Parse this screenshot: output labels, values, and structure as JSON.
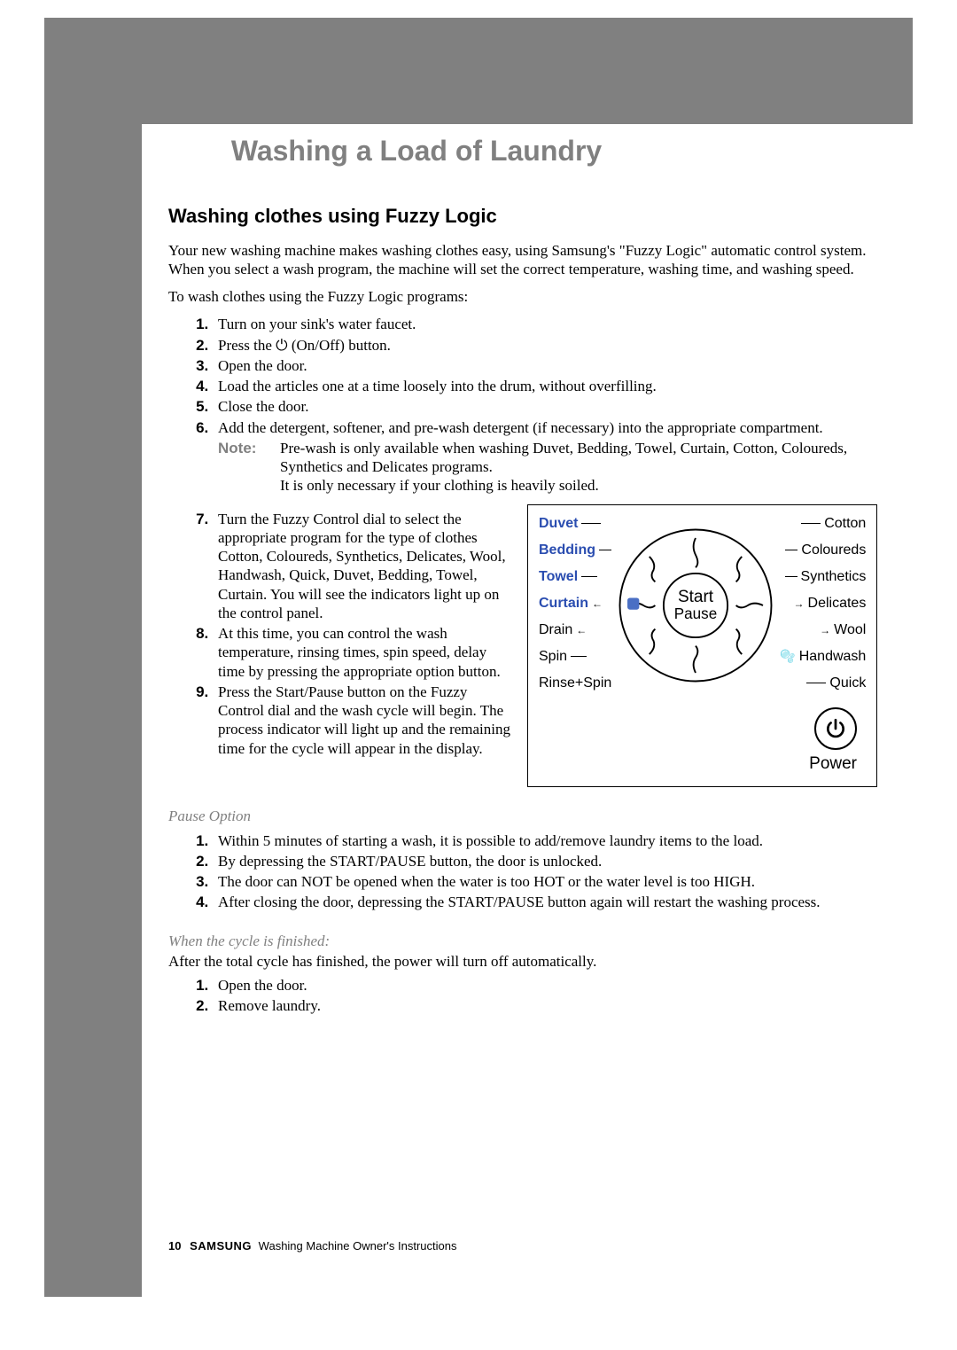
{
  "header": {
    "title": "Washing a Load of Laundry"
  },
  "section": {
    "heading": "Washing clothes using Fuzzy Logic",
    "intro1": "Your new washing machine makes washing clothes easy, using Samsung's \"Fuzzy Logic\" automatic control system.  When you select a wash program, the machine will set the correct temperature, washing time, and washing speed.",
    "intro2": "To wash clothes using the Fuzzy Logic programs:",
    "steps": [
      "Turn on your sink's water faucet.",
      "Press the ⏻ (On/Off) button.",
      "Open the door.",
      "Load the articles one at a time loosely into the drum, without overfilling.",
      "Close the door.",
      "Add the detergent, softener, and pre-wash detergent (if necessary) into the appropriate compartment.",
      "Turn the Fuzzy Control dial to select the appropriate program for the type of clothes Cotton, Coloureds, Synthetics, Delicates, Wool, Handwash, Quick, Duvet, Bedding, Towel, Curtain. You will see the indicators light up on the control panel.",
      "At this time, you can control the wash temperature, rinsing times, spin speed, delay time  by pressing the appropriate option button.",
      "Press the Start/Pause button on the Fuzzy Control dial and the wash cycle will begin. The process indicator will light up and the remaining time for the cycle will appear in the display."
    ],
    "note_label": "Note:",
    "note_body1": "Pre-wash is only available when washing Duvet, Bedding, Towel, Curtain, Cotton, Coloureds, Synthetics and Delicates programs.",
    "note_body2": "It is only necessary if your clothing is heavily soiled."
  },
  "diagram": {
    "left": [
      "Duvet",
      "Bedding",
      "Towel",
      "Curtain",
      "Drain",
      "Spin",
      "Rinse+Spin"
    ],
    "right": [
      "Cotton",
      "Coloureds",
      "Synthetics",
      "Delicates",
      "Wool",
      "Handwash",
      "Quick"
    ],
    "center_top": "Start",
    "center_bottom": "Pause",
    "power_label": "Power"
  },
  "pause_option": {
    "heading": "Pause Option",
    "items": [
      "Within 5 minutes of starting a wash, it is possible to add/remove laundry items to the load.",
      "By depressing the START/PAUSE button, the door is unlocked.",
      "The door can NOT be opened when the water is too HOT or the water level is too HIGH.",
      "After closing the door, depressing the START/PAUSE button again will restart the washing process."
    ]
  },
  "finished": {
    "heading": "When the cycle is finished:",
    "lead": "After the total cycle has finished, the power will turn off automatically.",
    "items": [
      "Open the door.",
      "Remove laundry."
    ]
  },
  "footer": {
    "page": "10",
    "brand": "SAMSUNG",
    "text": "Washing Machine Owner's Instructions"
  }
}
